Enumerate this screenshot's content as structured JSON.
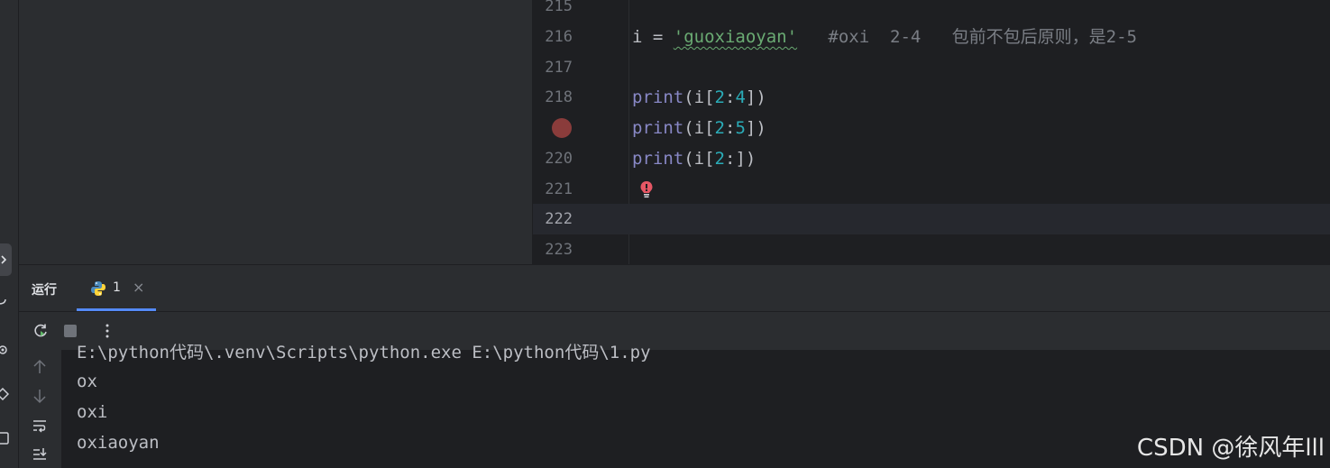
{
  "editor": {
    "lines": [
      {
        "num": "215",
        "code": ""
      },
      {
        "num": "216",
        "var": "i",
        "op": " = ",
        "str": "'guoxiaoyan'",
        "gap": "   ",
        "comment": "#oxi  2-4   包前不包后原则，是2-5"
      },
      {
        "num": "217",
        "code": ""
      },
      {
        "num": "218",
        "fn": "print",
        "p1": "(i[",
        "a": "2",
        "colon": ":",
        "b": "4",
        "p2": "])"
      },
      {
        "num": "",
        "fn": "print",
        "p1": "(i[",
        "a": "2",
        "colon": ":",
        "b": "5",
        "p2": "])"
      },
      {
        "num": "220",
        "fn": "print",
        "p1": "(i[",
        "a": "2",
        "colon": ":",
        "b": "",
        "p2": "])"
      },
      {
        "num": "221",
        "code": ""
      },
      {
        "num": "222",
        "code": ""
      },
      {
        "num": "223",
        "code": ""
      }
    ]
  },
  "run": {
    "title": "运行",
    "tab_label": "1",
    "tab_close": "×",
    "console_lines": [
      "E:\\python代码\\.venv\\Scripts\\python.exe E:\\python代码\\1.py",
      "ox",
      "oxi",
      "oxiaoyan"
    ]
  },
  "watermark": "CSDN @徐风年lll",
  "colors": {
    "builtin": "#8888c6",
    "string": "#6aab73",
    "number": "#2aacb8",
    "comment": "#7a7e85",
    "accent": "#548af7",
    "breakpoint": "#8a3c3b"
  },
  "icons": {
    "rerun": "rerun-icon",
    "stop": "stop-icon",
    "more": "more-vertical-icon",
    "up": "arrow-up-icon",
    "down": "arrow-down-icon",
    "wrap": "soft-wrap-icon",
    "scroll_end": "scroll-to-end-icon",
    "python": "python-icon",
    "bulb": "error-bulb-icon",
    "breakpoint": "breakpoint-icon"
  }
}
